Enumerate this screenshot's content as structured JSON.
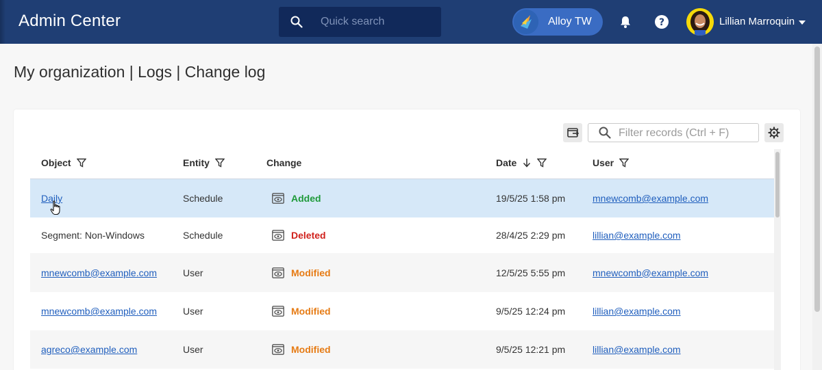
{
  "header": {
    "app_title": "Admin Center",
    "search_placeholder": "Quick search",
    "tenant_name": "Alloy TW",
    "user_name": "Lillian Marroquin",
    "icons": [
      "search-icon",
      "bell-icon",
      "help-icon",
      "chevron-down-icon"
    ]
  },
  "page": {
    "breadcrumb": "My organization | Logs | Change log"
  },
  "toolbar": {
    "filter_placeholder": "Filter records (Ctrl + F)",
    "icons": [
      "export-icon",
      "search-icon",
      "gear-icon"
    ]
  },
  "table": {
    "columns": [
      {
        "label": "Object",
        "filter": true
      },
      {
        "label": "Entity",
        "filter": true
      },
      {
        "label": "Change",
        "filter": false
      },
      {
        "label": "Date",
        "filter": true,
        "sort": "descending"
      },
      {
        "label": "User",
        "filter": true
      }
    ],
    "rows": [
      {
        "object": "Daily",
        "object_link": true,
        "entity": "Schedule",
        "change": "Added",
        "date": "19/5/25 1:58 pm",
        "user": "mnewcomb@example.com",
        "selected": true
      },
      {
        "object": "Segment: Non-Windows",
        "object_link": false,
        "entity": "Schedule",
        "change": "Deleted",
        "date": "28/4/25 2:29 pm",
        "user": "lillian@example.com",
        "selected": false
      },
      {
        "object": "mnewcomb@example.com",
        "object_link": true,
        "entity": "User",
        "change": "Modified",
        "date": "12/5/25 5:55 pm",
        "user": "mnewcomb@example.com",
        "selected": false
      },
      {
        "object": "mnewcomb@example.com",
        "object_link": true,
        "entity": "User",
        "change": "Modified",
        "date": "9/5/25 12:24 pm",
        "user": "lillian@example.com",
        "selected": false
      },
      {
        "object": "agreco@example.com",
        "object_link": true,
        "entity": "User",
        "change": "Modified",
        "date": "9/5/25 12:21 pm",
        "user": "lillian@example.com",
        "selected": false
      }
    ]
  },
  "colors": {
    "topbar": "#1f3e74",
    "tenant_pill": "#3a6cc3",
    "link": "#1f5ebd",
    "added": "#1f9a3a",
    "deleted": "#d0211c",
    "modified": "#e67b14",
    "selected_row": "#d6e8f8"
  }
}
